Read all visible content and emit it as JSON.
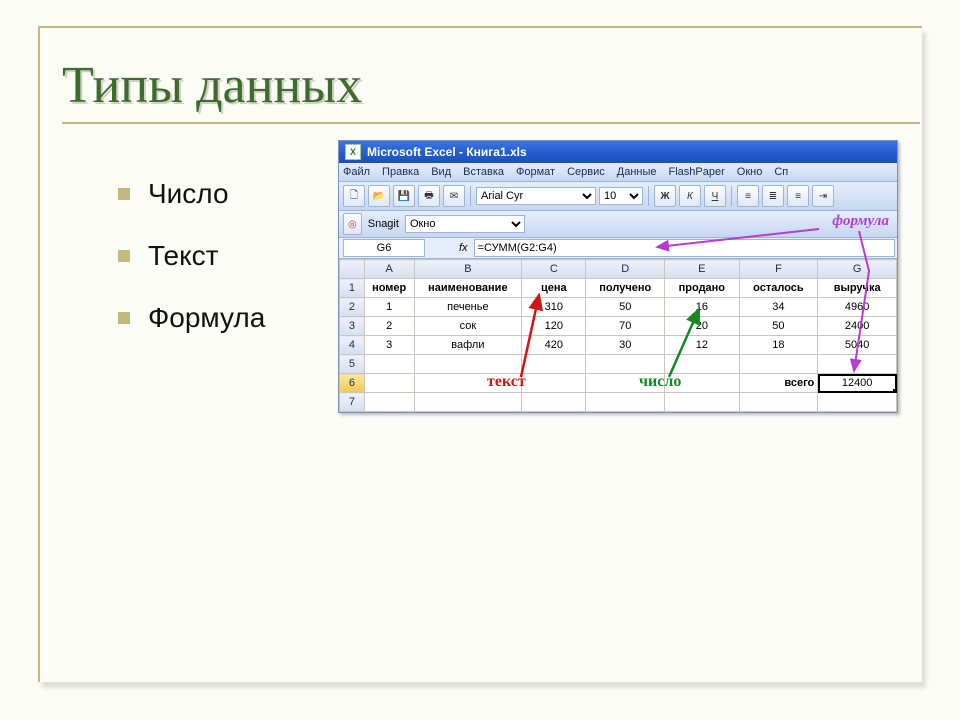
{
  "slide": {
    "title": "Типы данных",
    "bullets": [
      "Число",
      "Текст",
      "Формула"
    ]
  },
  "excel": {
    "app_title": "Microsoft Excel - Книга1.xls",
    "icon_text": "X",
    "menu": [
      "Файл",
      "Правка",
      "Вид",
      "Вставка",
      "Формат",
      "Сервис",
      "Данные",
      "FlashPaper",
      "Окно",
      "Сп"
    ],
    "font_name": "Arial Cyr",
    "font_size": "10",
    "snagit_label": "Snagit",
    "snagit_window": "Окно",
    "formula_label": "формула",
    "namebox": "G6",
    "fx_label": "fx",
    "formula_value": "=СУММ(G2:G4)",
    "col_heads": [
      "A",
      "B",
      "C",
      "D",
      "E",
      "F",
      "G"
    ],
    "row_heads": [
      "1",
      "2",
      "3",
      "4",
      "5",
      "6",
      "7"
    ],
    "header_row": [
      "номер",
      "наименование",
      "цена",
      "получено",
      "продано",
      "осталось",
      "выручка"
    ],
    "rows": [
      [
        "1",
        "печенье",
        "310",
        "50",
        "16",
        "34",
        "4960"
      ],
      [
        "2",
        "сок",
        "120",
        "70",
        "20",
        "50",
        "2400"
      ],
      [
        "3",
        "вафли",
        "420",
        "30",
        "12",
        "18",
        "5040"
      ]
    ],
    "total_label": "всего",
    "total_value": "12400",
    "ann_text": "текст",
    "ann_number": "число"
  },
  "chart_data": {
    "type": "table",
    "title": "Типы данных (Excel пример)",
    "columns": [
      "номер",
      "наименование",
      "цена",
      "получено",
      "продано",
      "осталось",
      "выручка"
    ],
    "rows": [
      [
        1,
        "печенье",
        310,
        50,
        16,
        34,
        4960
      ],
      [
        2,
        "сок",
        120,
        70,
        20,
        50,
        2400
      ],
      [
        3,
        "вафли",
        420,
        30,
        12,
        18,
        5040
      ]
    ],
    "totals": {
      "выручка": 12400
    },
    "formula_cell": "G6",
    "formula": "=СУММ(G2:G4)"
  }
}
